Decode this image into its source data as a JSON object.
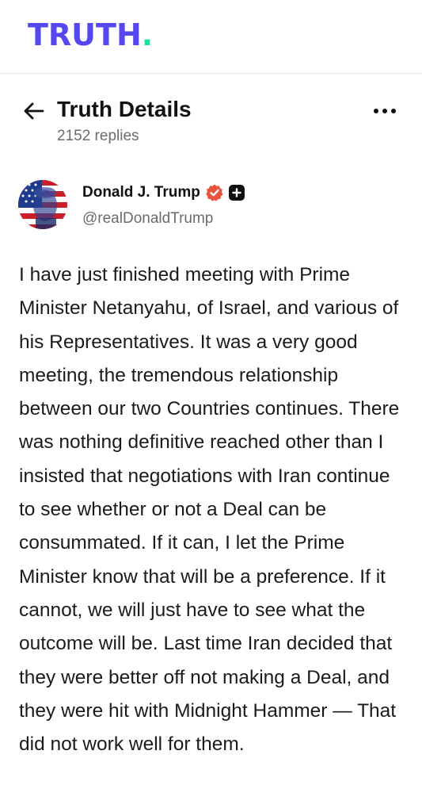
{
  "app": {
    "logo_text": "TRUTH",
    "logo_dot": ".",
    "brand_color": "#5448ee",
    "accent_color": "#17e3a6"
  },
  "header": {
    "back_icon": "arrow-left-icon",
    "title": "Truth Details",
    "replies": "2152 replies",
    "more_icon": "more-horizontal-icon"
  },
  "post": {
    "author": {
      "name": "Donald J. Trump",
      "handle": "@realDonaldTrump",
      "verified_icon": "verified-badge-icon",
      "verified_color": "#e8553a",
      "plus_icon": "plus-badge-icon"
    },
    "text": "I have just finished meeting with Prime Minister Netanyahu, of Israel, and various of his Representatives. It was a very good meeting, the tremendous relationship between our two Countries continues. There was nothing definitive reached other than I insisted that negotiations with Iran continue to see whether or not a Deal can be consummated. If it can, I let the Prime Minister know that will be a preference. If it cannot, we will just have to see what the outcome will be. Last time Iran decided that they were better off not making a Deal, and they were hit with Midnight Hammer — That did not work well for them."
  }
}
